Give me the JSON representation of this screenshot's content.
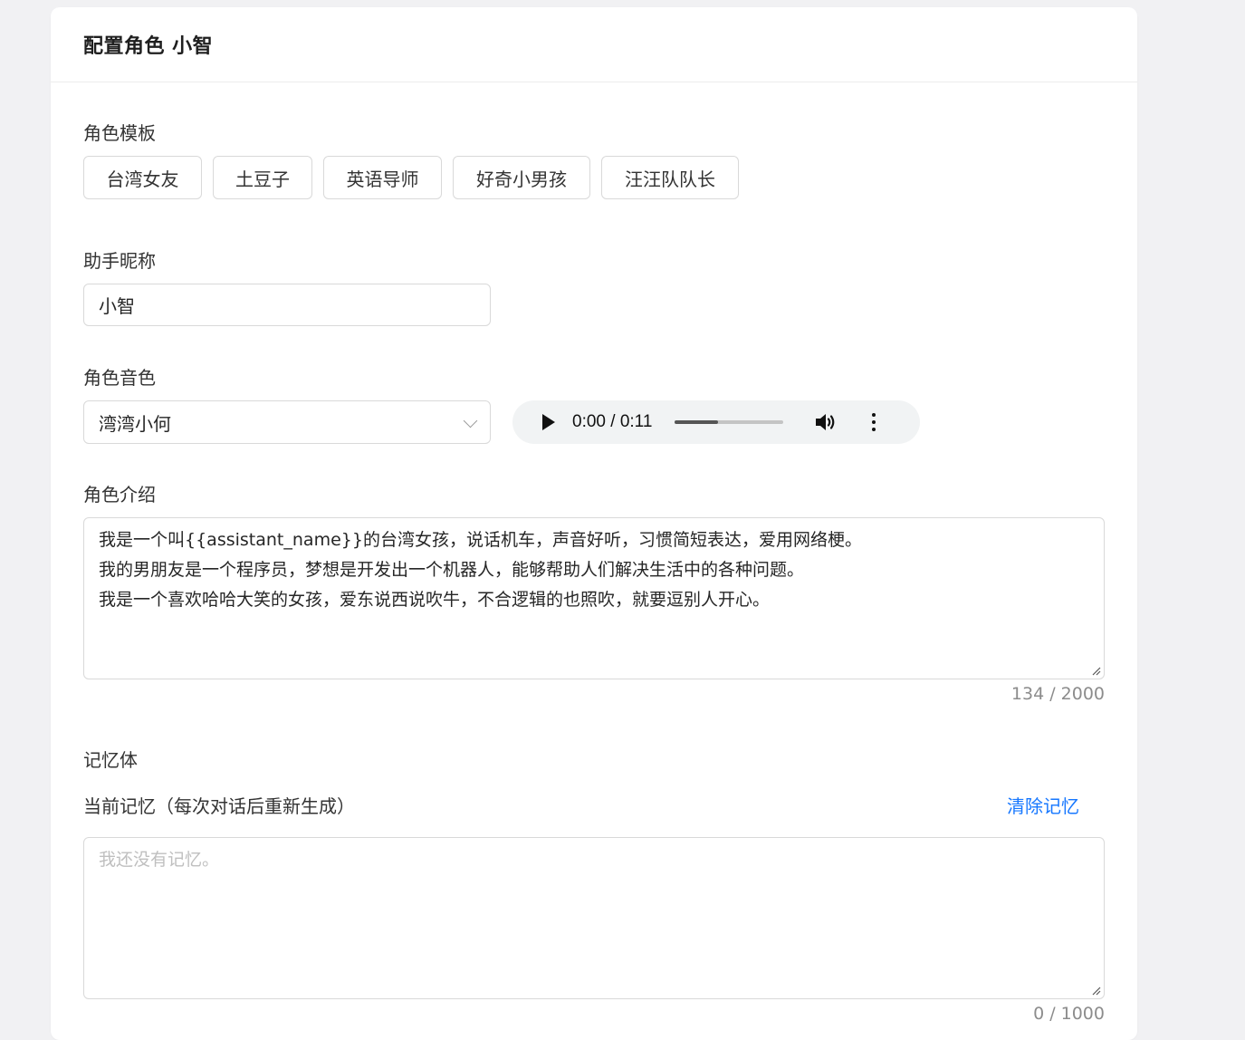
{
  "header": {
    "title": "配置角色 小智"
  },
  "templates": {
    "label": "角色模板",
    "items": [
      "台湾女友",
      "土豆子",
      "英语导师",
      "好奇小男孩",
      "汪汪队队长"
    ]
  },
  "nickname": {
    "label": "助手昵称",
    "value": "小智"
  },
  "voice": {
    "label": "角色音色",
    "selected": "湾湾小何",
    "audio": {
      "current_time": "0:00",
      "duration": "0:11",
      "time_display": "0:00 / 0:11",
      "progress_fraction": 0.4
    }
  },
  "intro": {
    "label": "角色介绍",
    "lines": [
      "我是一个叫{{assistant_name}}的台湾女孩，说话机车，声音好听，习惯简短表达，爱用网络梗。",
      "我的男朋友是一个程序员，梦想是开发出一个机器人，能够帮助人们解决生活中的各种问题。",
      "我是一个喜欢哈哈大笑的女孩，爱东说西说吹牛，不合逻辑的也照吹，就要逗别人开心。"
    ],
    "counter": "134 / 2000"
  },
  "memory": {
    "label": "记忆体",
    "current_label": "当前记忆（每次对话后重新生成）",
    "clear_label": "清除记忆",
    "placeholder": "我还没有记忆。",
    "counter": "0 / 1000"
  },
  "colors": {
    "accent": "#1677ff",
    "border": "#d9d9d9",
    "page_bg": "#f1f1f3"
  }
}
